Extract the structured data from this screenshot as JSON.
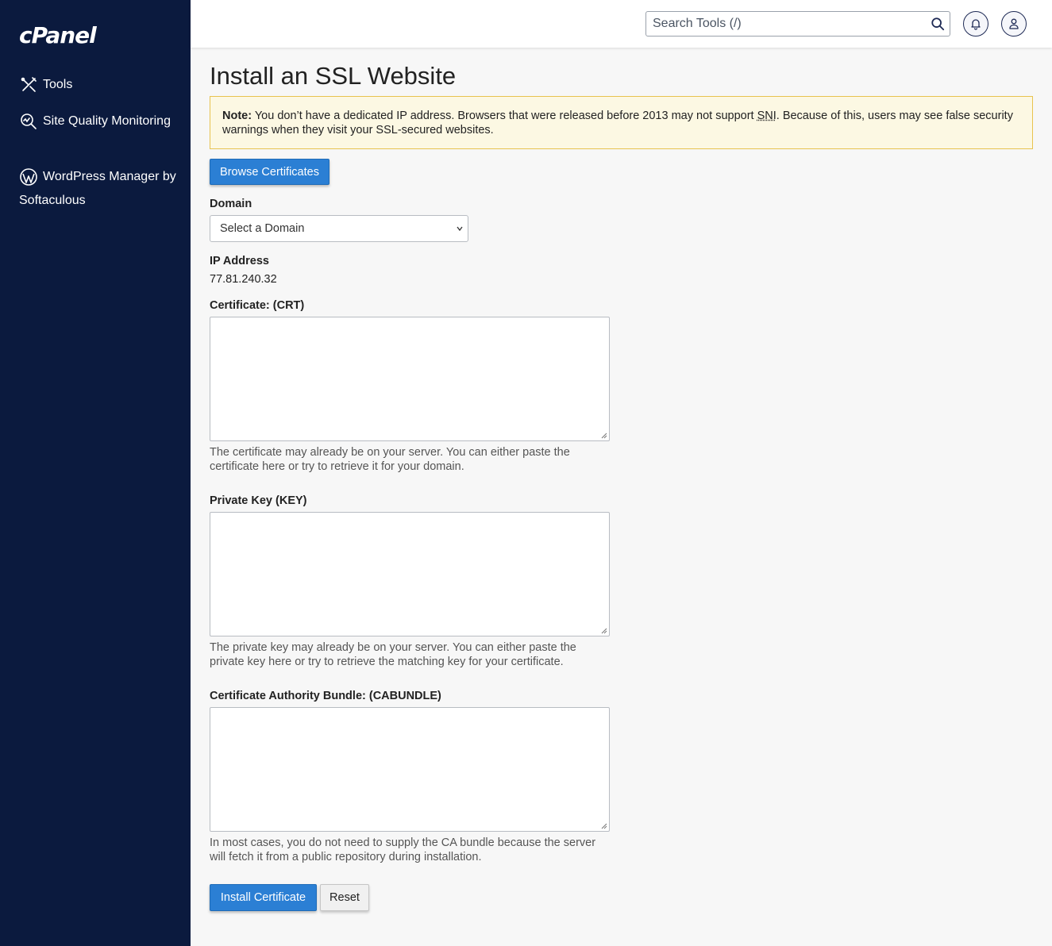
{
  "brand": {
    "logo_text": "cPanel"
  },
  "sidebar": {
    "items": [
      {
        "label": "Tools",
        "icon": "tools-icon"
      },
      {
        "label": "Site Quality Monitoring",
        "icon": "site-quality-icon"
      },
      {
        "label": "WordPress Manager by Softaculous",
        "icon": "wordpress-icon"
      }
    ]
  },
  "header": {
    "search_placeholder": "Search Tools (/)",
    "icons": [
      "search-icon",
      "bell-icon",
      "user-icon"
    ]
  },
  "page": {
    "title": "Install an SSL Website",
    "note": {
      "bold": "Note:",
      "text_before": " You don’t have a dedicated IP address. Browsers that were released before 2013 may not support ",
      "abbr": "SNI",
      "text_after": ". Because of this, users may see false security warnings when they visit your SSL-secured websites."
    },
    "browse_button": "Browse Certificates",
    "domain": {
      "label": "Domain",
      "selected": "Select a Domain"
    },
    "ip": {
      "label": "IP Address",
      "value": "77.81.240.32"
    },
    "certificate": {
      "label": "Certificate: (CRT)",
      "value": "",
      "help": "The certificate may already be on your server. You can either paste the certificate here or try to retrieve it for your domain."
    },
    "private_key": {
      "label": "Private Key (KEY)",
      "value": "",
      "help": "The private key may already be on your server. You can either paste the private key here or try to retrieve the matching key for your certificate."
    },
    "ca_bundle": {
      "label": "Certificate Authority Bundle: (CABUNDLE)",
      "value": "",
      "help": "In most cases, you do not need to supply the CA bundle because the server will fetch it from a public repository during installation."
    },
    "install_button": "Install Certificate",
    "reset_button": "Reset"
  },
  "colors": {
    "sidebar_bg": "#0b1a3e",
    "primary": "#2b7fd4",
    "note_bg": "#fcf8e3",
    "note_border": "#e8c34f"
  }
}
